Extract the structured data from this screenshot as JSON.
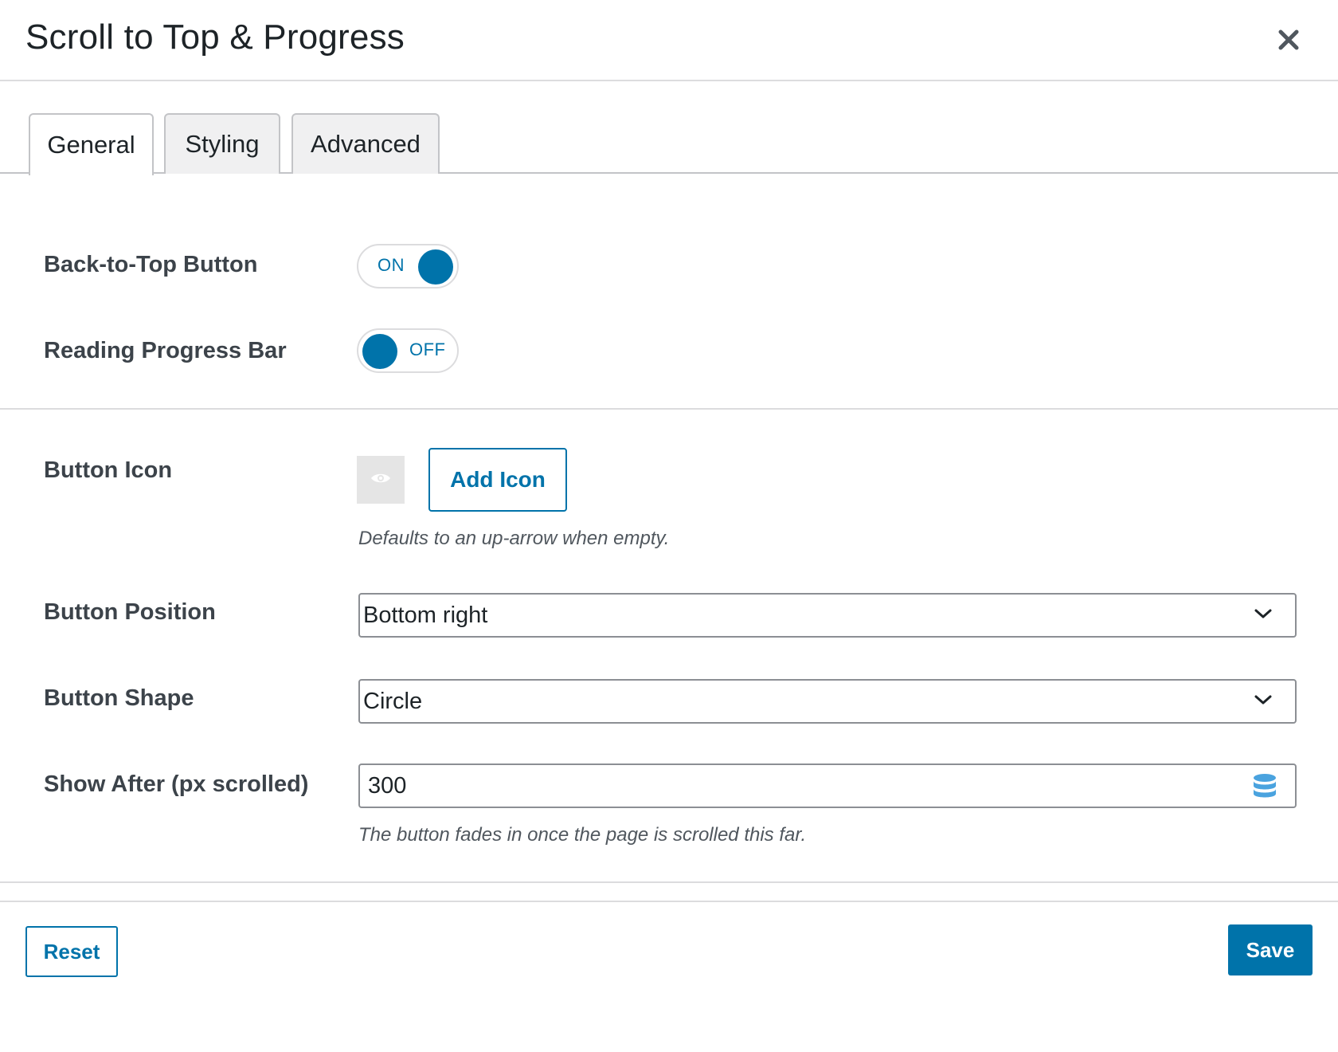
{
  "dialog": {
    "title": "Scroll to Top & Progress",
    "close_icon": "close-icon"
  },
  "tabs": [
    {
      "label": "General",
      "active": true
    },
    {
      "label": "Styling",
      "active": false
    },
    {
      "label": "Advanced",
      "active": false
    }
  ],
  "general": {
    "back_to_top": {
      "label": "Back-to-Top Button",
      "state": "ON",
      "enabled": true
    },
    "progress_bar": {
      "label": "Reading Progress Bar",
      "state": "OFF",
      "enabled": false
    },
    "button_icon": {
      "label": "Button Icon",
      "preview_icon": "eye-icon",
      "add_label": "Add Icon",
      "help": "Defaults to an up-arrow when empty."
    },
    "button_position": {
      "label": "Button Position",
      "value": "Bottom right"
    },
    "button_shape": {
      "label": "Button Shape",
      "value": "Circle"
    },
    "show_after": {
      "label": "Show After (px scrolled)",
      "value": "300",
      "icon": "database-icon",
      "help": "The button fades in once the page is scrolled this far."
    }
  },
  "footer": {
    "reset_label": "Reset",
    "save_label": "Save"
  },
  "colors": {
    "accent": "#0073aa",
    "border": "#dcdcde",
    "text": "#3c434a"
  }
}
